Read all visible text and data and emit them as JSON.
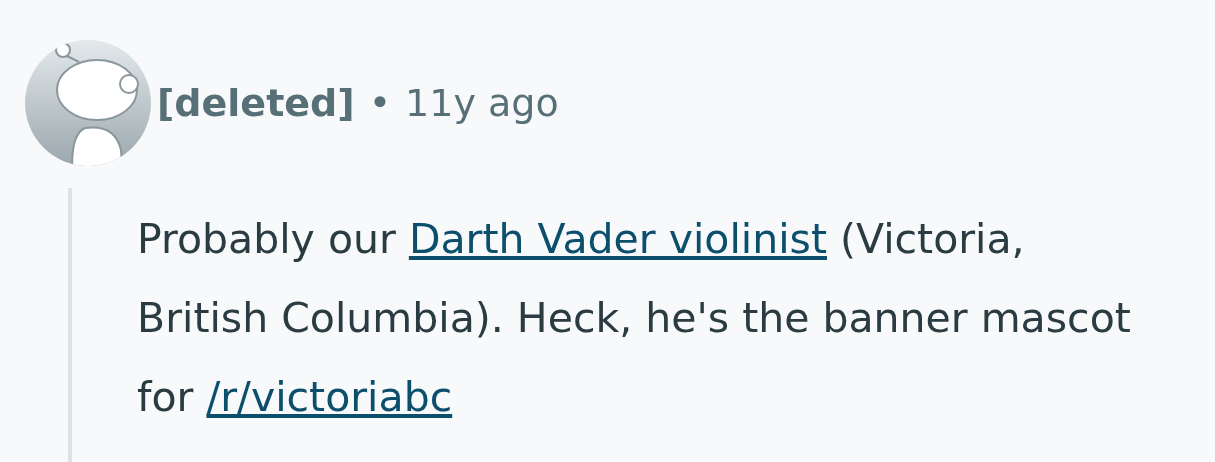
{
  "comment": {
    "author": "[deleted]",
    "separator": "•",
    "age": "11y ago",
    "body": [
      {
        "kind": "text",
        "text": "Probably our "
      },
      {
        "kind": "link",
        "text": "Darth Vader violinist"
      },
      {
        "kind": "text",
        "text": " (Victoria, British Columbia). Heck, he's the banner mascot for "
      },
      {
        "kind": "link",
        "text": "/r/victoriabc"
      }
    ]
  }
}
